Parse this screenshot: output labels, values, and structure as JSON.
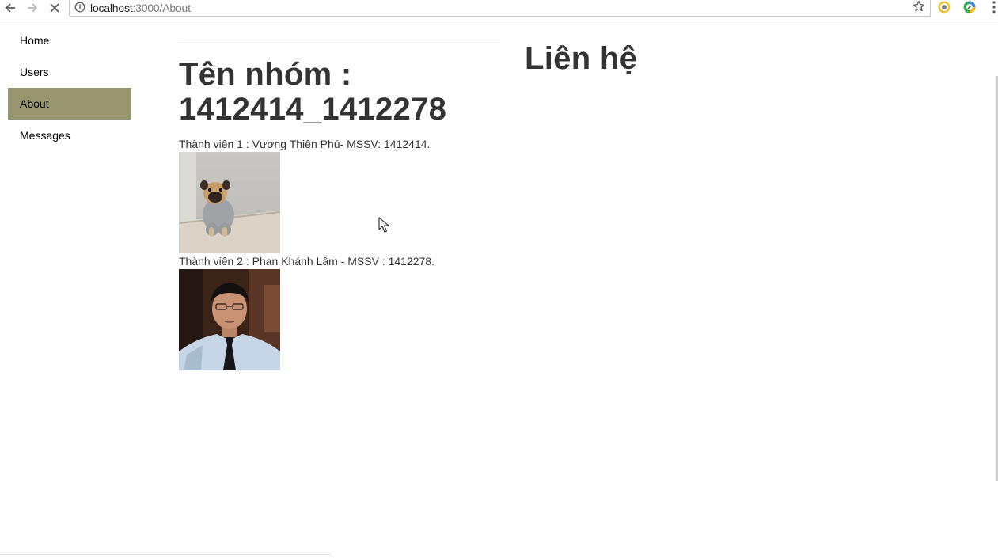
{
  "browser": {
    "url_host": "localhost",
    "url_path": ":3000/About",
    "icons": {
      "back": "back-arrow-icon",
      "forward": "forward-arrow-icon",
      "stop": "stop-loading-icon",
      "info": "info-icon",
      "bookmark": "star-icon",
      "extension_1": "extension-icon",
      "extension_2": "extension-icon",
      "menu": "kebab-menu-icon"
    }
  },
  "sidebar": {
    "items": [
      {
        "label": "Home",
        "active": false
      },
      {
        "label": "Users",
        "active": false
      },
      {
        "label": "About",
        "active": true
      },
      {
        "label": "Messages",
        "active": false
      }
    ],
    "active_color": "#979670"
  },
  "main": {
    "group_title_line1": "Tên nhóm :",
    "group_title_line2": "1412414_1412278",
    "members": [
      {
        "text": "Thành viên 1 : Vương Thiên Phú- MSSV: 1412414.",
        "photo": "pug-dog-photo"
      },
      {
        "text": "Thành viên 2 : Phan Khánh Lâm - MSSV : 1412278.",
        "photo": "member-portrait-photo"
      }
    ]
  },
  "contact": {
    "title": "Liên hệ"
  }
}
